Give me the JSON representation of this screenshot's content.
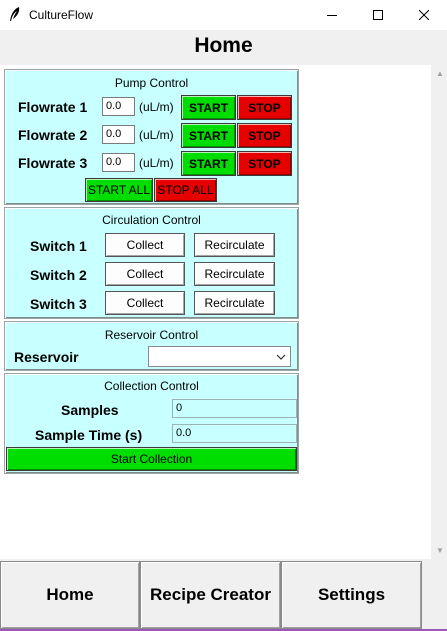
{
  "window": {
    "title": "CultureFlow"
  },
  "header": {
    "title": "Home"
  },
  "pump_control": {
    "title": "Pump Control",
    "rows": [
      {
        "label": "Flowrate 1",
        "value": "0.0",
        "unit": "(uL/m)",
        "start": "START",
        "stop": "STOP"
      },
      {
        "label": "Flowrate 2",
        "value": "0.0",
        "unit": "(uL/m)",
        "start": "START",
        "stop": "STOP"
      },
      {
        "label": "Flowrate 3",
        "value": "0.0",
        "unit": "(uL/m)",
        "start": "START",
        "stop": "STOP"
      }
    ],
    "start_all": "START ALL",
    "stop_all": "STOP ALL"
  },
  "circulation_control": {
    "title": "Circulation Control",
    "rows": [
      {
        "label": "Switch 1",
        "collect": "Collect",
        "recirculate": "Recirculate"
      },
      {
        "label": "Switch 2",
        "collect": "Collect",
        "recirculate": "Recirculate"
      },
      {
        "label": "Switch 3",
        "collect": "Collect",
        "recirculate": "Recirculate"
      }
    ]
  },
  "reservoir_control": {
    "title": "Reservoir Control",
    "label": "Reservoir",
    "selected": ""
  },
  "collection_control": {
    "title": "Collection Control",
    "samples_label": "Samples",
    "samples_value": "0",
    "sample_time_label": "Sample Time (s)",
    "sample_time_value": "0.0",
    "start_button": "Start Collection"
  },
  "nav": {
    "home": "Home",
    "recipe_creator": "Recipe Creator",
    "settings": "Settings"
  },
  "colors": {
    "panel_bg": "#c8ffff",
    "start_green": "#00dd00",
    "stop_red": "#e60000"
  },
  "icons": {
    "app": "feather-icon",
    "minimize": "minimize-icon",
    "maximize": "maximize-icon",
    "close": "close-icon"
  }
}
